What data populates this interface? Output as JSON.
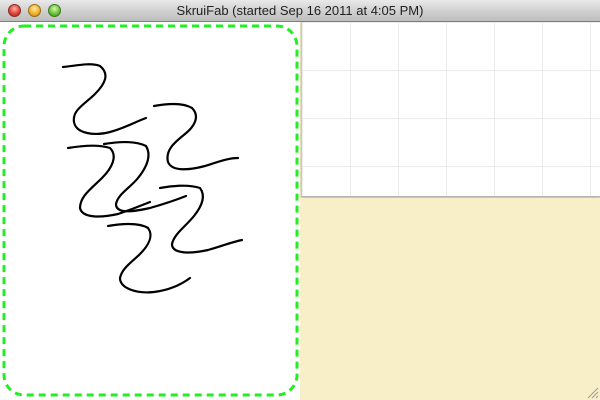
{
  "window": {
    "title": "SkruiFab (started Sep 16 2011 at 4:05 PM)"
  },
  "colors": {
    "selection_outline": "#22ee22",
    "stroke": "#000000",
    "tray_background": "#f8efc8",
    "grid_lines": "#ececec"
  },
  "icons": {
    "close": "close-button-icon",
    "minimize": "minimize-button-icon",
    "zoom": "zoom-button-icon",
    "resize": "resize-grip-icon"
  }
}
